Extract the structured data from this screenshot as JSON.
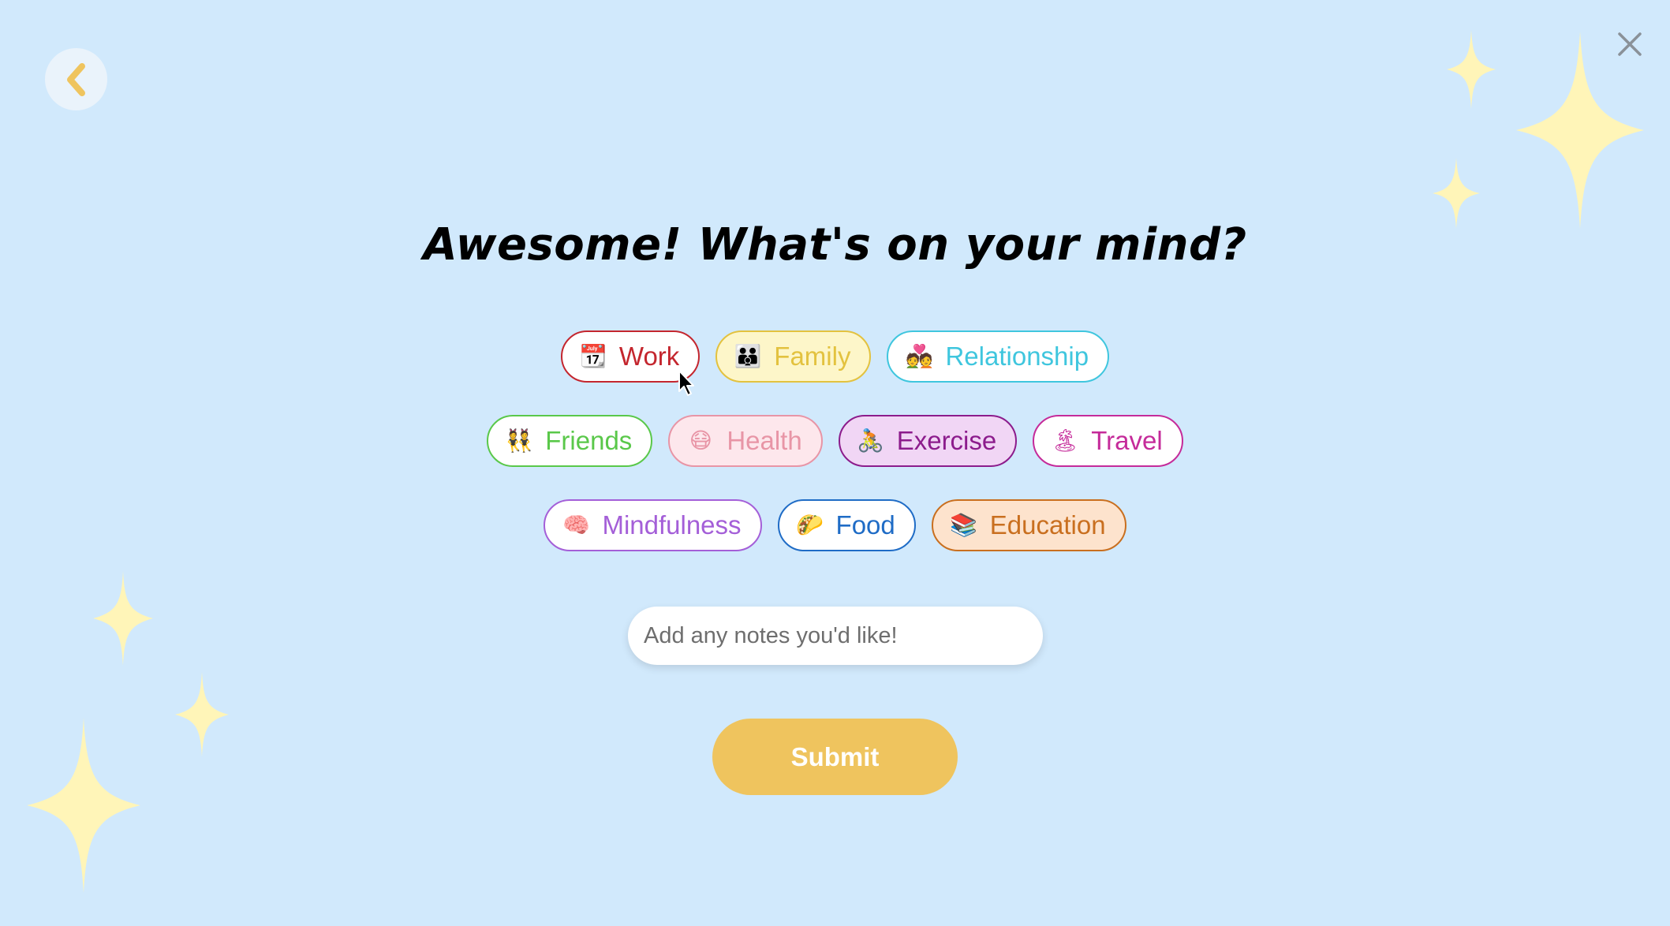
{
  "header": {
    "back_icon": "chevron-left-icon",
    "close_icon": "close-icon"
  },
  "title": "Awesome! What's on your mind?",
  "categories": [
    {
      "label": "Work",
      "emoji": "📆",
      "icon": "calendar-icon",
      "color": "#c4262e",
      "bg": "#ffffff",
      "selected": true
    },
    {
      "label": "Family",
      "emoji": "👪",
      "icon": "family-icon",
      "color": "#e3c23f",
      "bg": "#fdf6c9",
      "selected": false
    },
    {
      "label": "Relationship",
      "emoji": "💑",
      "icon": "couple-icon",
      "color": "#3fc6de",
      "bg": "#ffffff",
      "selected": false
    },
    {
      "label": "Friends",
      "emoji": "👯",
      "icon": "friends-icon",
      "color": "#5ac84a",
      "bg": "#ffffff",
      "selected": false
    },
    {
      "label": "Health",
      "emoji": "😷",
      "icon": "mask-face-icon",
      "color": "#e895a6",
      "bg": "#fde7ec",
      "selected": false
    },
    {
      "label": "Exercise",
      "emoji": "🚴",
      "icon": "cyclist-icon",
      "color": "#8c1c8c",
      "bg": "#f1d6f5",
      "selected": false
    },
    {
      "label": "Travel",
      "emoji": "🏝",
      "icon": "island-icon",
      "color": "#c52b9a",
      "bg": "#ffffff",
      "selected": false
    },
    {
      "label": "Mindfulness",
      "emoji": "🧠",
      "icon": "brain-icon",
      "color": "#a45fd8",
      "bg": "#ffffff",
      "selected": false
    },
    {
      "label": "Food",
      "emoji": "🌮",
      "icon": "taco-icon",
      "color": "#1f6cc6",
      "bg": "#ffffff",
      "selected": false
    },
    {
      "label": "Education",
      "emoji": "📚",
      "icon": "books-icon",
      "color": "#c96f1f",
      "bg": "#fde3cd",
      "selected": false
    }
  ],
  "notes": {
    "placeholder": "Add any notes you'd like!",
    "value": ""
  },
  "submit_label": "Submit",
  "colors": {
    "background": "#d1e9fc",
    "sparkle": "#fff5b8",
    "submit": "#efc45e",
    "back_chevron": "#efc45e"
  }
}
